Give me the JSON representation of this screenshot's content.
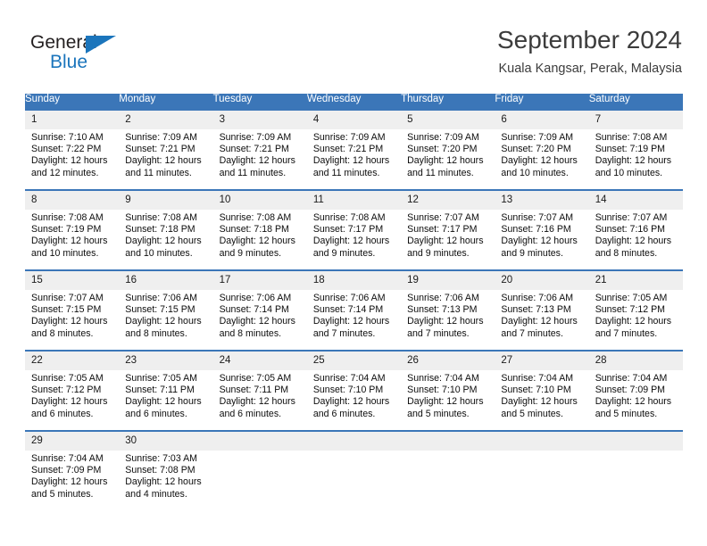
{
  "logo": {
    "word_top": "General",
    "word_bottom": "Blue",
    "triangle_icon": "blue-triangle-icon",
    "color_text": "#231f20",
    "color_blue": "#1b75bc"
  },
  "header": {
    "title": "September 2024",
    "subtitle": "Kuala Kangsar, Perak, Malaysia"
  },
  "theme": {
    "header_blue": "#3b76b8",
    "daynum_band": "#efefef",
    "text": "#0d0d0d"
  },
  "calendar": {
    "weekday_headers": [
      "Sunday",
      "Monday",
      "Tuesday",
      "Wednesday",
      "Thursday",
      "Friday",
      "Saturday"
    ],
    "weeks": [
      [
        {
          "day": "1",
          "sunrise": "Sunrise: 7:10 AM",
          "sunset": "Sunset: 7:22 PM",
          "daylight_line1": "Daylight: 12 hours",
          "daylight_line2": "and 12 minutes."
        },
        {
          "day": "2",
          "sunrise": "Sunrise: 7:09 AM",
          "sunset": "Sunset: 7:21 PM",
          "daylight_line1": "Daylight: 12 hours",
          "daylight_line2": "and 11 minutes."
        },
        {
          "day": "3",
          "sunrise": "Sunrise: 7:09 AM",
          "sunset": "Sunset: 7:21 PM",
          "daylight_line1": "Daylight: 12 hours",
          "daylight_line2": "and 11 minutes."
        },
        {
          "day": "4",
          "sunrise": "Sunrise: 7:09 AM",
          "sunset": "Sunset: 7:21 PM",
          "daylight_line1": "Daylight: 12 hours",
          "daylight_line2": "and 11 minutes."
        },
        {
          "day": "5",
          "sunrise": "Sunrise: 7:09 AM",
          "sunset": "Sunset: 7:20 PM",
          "daylight_line1": "Daylight: 12 hours",
          "daylight_line2": "and 11 minutes."
        },
        {
          "day": "6",
          "sunrise": "Sunrise: 7:09 AM",
          "sunset": "Sunset: 7:20 PM",
          "daylight_line1": "Daylight: 12 hours",
          "daylight_line2": "and 10 minutes."
        },
        {
          "day": "7",
          "sunrise": "Sunrise: 7:08 AM",
          "sunset": "Sunset: 7:19 PM",
          "daylight_line1": "Daylight: 12 hours",
          "daylight_line2": "and 10 minutes."
        }
      ],
      [
        {
          "day": "8",
          "sunrise": "Sunrise: 7:08 AM",
          "sunset": "Sunset: 7:19 PM",
          "daylight_line1": "Daylight: 12 hours",
          "daylight_line2": "and 10 minutes."
        },
        {
          "day": "9",
          "sunrise": "Sunrise: 7:08 AM",
          "sunset": "Sunset: 7:18 PM",
          "daylight_line1": "Daylight: 12 hours",
          "daylight_line2": "and 10 minutes."
        },
        {
          "day": "10",
          "sunrise": "Sunrise: 7:08 AM",
          "sunset": "Sunset: 7:18 PM",
          "daylight_line1": "Daylight: 12 hours",
          "daylight_line2": "and 9 minutes."
        },
        {
          "day": "11",
          "sunrise": "Sunrise: 7:08 AM",
          "sunset": "Sunset: 7:17 PM",
          "daylight_line1": "Daylight: 12 hours",
          "daylight_line2": "and 9 minutes."
        },
        {
          "day": "12",
          "sunrise": "Sunrise: 7:07 AM",
          "sunset": "Sunset: 7:17 PM",
          "daylight_line1": "Daylight: 12 hours",
          "daylight_line2": "and 9 minutes."
        },
        {
          "day": "13",
          "sunrise": "Sunrise: 7:07 AM",
          "sunset": "Sunset: 7:16 PM",
          "daylight_line1": "Daylight: 12 hours",
          "daylight_line2": "and 9 minutes."
        },
        {
          "day": "14",
          "sunrise": "Sunrise: 7:07 AM",
          "sunset": "Sunset: 7:16 PM",
          "daylight_line1": "Daylight: 12 hours",
          "daylight_line2": "and 8 minutes."
        }
      ],
      [
        {
          "day": "15",
          "sunrise": "Sunrise: 7:07 AM",
          "sunset": "Sunset: 7:15 PM",
          "daylight_line1": "Daylight: 12 hours",
          "daylight_line2": "and 8 minutes."
        },
        {
          "day": "16",
          "sunrise": "Sunrise: 7:06 AM",
          "sunset": "Sunset: 7:15 PM",
          "daylight_line1": "Daylight: 12 hours",
          "daylight_line2": "and 8 minutes."
        },
        {
          "day": "17",
          "sunrise": "Sunrise: 7:06 AM",
          "sunset": "Sunset: 7:14 PM",
          "daylight_line1": "Daylight: 12 hours",
          "daylight_line2": "and 8 minutes."
        },
        {
          "day": "18",
          "sunrise": "Sunrise: 7:06 AM",
          "sunset": "Sunset: 7:14 PM",
          "daylight_line1": "Daylight: 12 hours",
          "daylight_line2": "and 7 minutes."
        },
        {
          "day": "19",
          "sunrise": "Sunrise: 7:06 AM",
          "sunset": "Sunset: 7:13 PM",
          "daylight_line1": "Daylight: 12 hours",
          "daylight_line2": "and 7 minutes."
        },
        {
          "day": "20",
          "sunrise": "Sunrise: 7:06 AM",
          "sunset": "Sunset: 7:13 PM",
          "daylight_line1": "Daylight: 12 hours",
          "daylight_line2": "and 7 minutes."
        },
        {
          "day": "21",
          "sunrise": "Sunrise: 7:05 AM",
          "sunset": "Sunset: 7:12 PM",
          "daylight_line1": "Daylight: 12 hours",
          "daylight_line2": "and 7 minutes."
        }
      ],
      [
        {
          "day": "22",
          "sunrise": "Sunrise: 7:05 AM",
          "sunset": "Sunset: 7:12 PM",
          "daylight_line1": "Daylight: 12 hours",
          "daylight_line2": "and 6 minutes."
        },
        {
          "day": "23",
          "sunrise": "Sunrise: 7:05 AM",
          "sunset": "Sunset: 7:11 PM",
          "daylight_line1": "Daylight: 12 hours",
          "daylight_line2": "and 6 minutes."
        },
        {
          "day": "24",
          "sunrise": "Sunrise: 7:05 AM",
          "sunset": "Sunset: 7:11 PM",
          "daylight_line1": "Daylight: 12 hours",
          "daylight_line2": "and 6 minutes."
        },
        {
          "day": "25",
          "sunrise": "Sunrise: 7:04 AM",
          "sunset": "Sunset: 7:10 PM",
          "daylight_line1": "Daylight: 12 hours",
          "daylight_line2": "and 6 minutes."
        },
        {
          "day": "26",
          "sunrise": "Sunrise: 7:04 AM",
          "sunset": "Sunset: 7:10 PM",
          "daylight_line1": "Daylight: 12 hours",
          "daylight_line2": "and 5 minutes."
        },
        {
          "day": "27",
          "sunrise": "Sunrise: 7:04 AM",
          "sunset": "Sunset: 7:10 PM",
          "daylight_line1": "Daylight: 12 hours",
          "daylight_line2": "and 5 minutes."
        },
        {
          "day": "28",
          "sunrise": "Sunrise: 7:04 AM",
          "sunset": "Sunset: 7:09 PM",
          "daylight_line1": "Daylight: 12 hours",
          "daylight_line2": "and 5 minutes."
        }
      ],
      [
        {
          "day": "29",
          "sunrise": "Sunrise: 7:04 AM",
          "sunset": "Sunset: 7:09 PM",
          "daylight_line1": "Daylight: 12 hours",
          "daylight_line2": "and 5 minutes."
        },
        {
          "day": "30",
          "sunrise": "Sunrise: 7:03 AM",
          "sunset": "Sunset: 7:08 PM",
          "daylight_line1": "Daylight: 12 hours",
          "daylight_line2": "and 4 minutes."
        },
        {
          "day": "",
          "sunrise": "",
          "sunset": "",
          "daylight_line1": "",
          "daylight_line2": ""
        },
        {
          "day": "",
          "sunrise": "",
          "sunset": "",
          "daylight_line1": "",
          "daylight_line2": ""
        },
        {
          "day": "",
          "sunrise": "",
          "sunset": "",
          "daylight_line1": "",
          "daylight_line2": ""
        },
        {
          "day": "",
          "sunrise": "",
          "sunset": "",
          "daylight_line1": "",
          "daylight_line2": ""
        },
        {
          "day": "",
          "sunrise": "",
          "sunset": "",
          "daylight_line1": "",
          "daylight_line2": ""
        }
      ]
    ]
  }
}
